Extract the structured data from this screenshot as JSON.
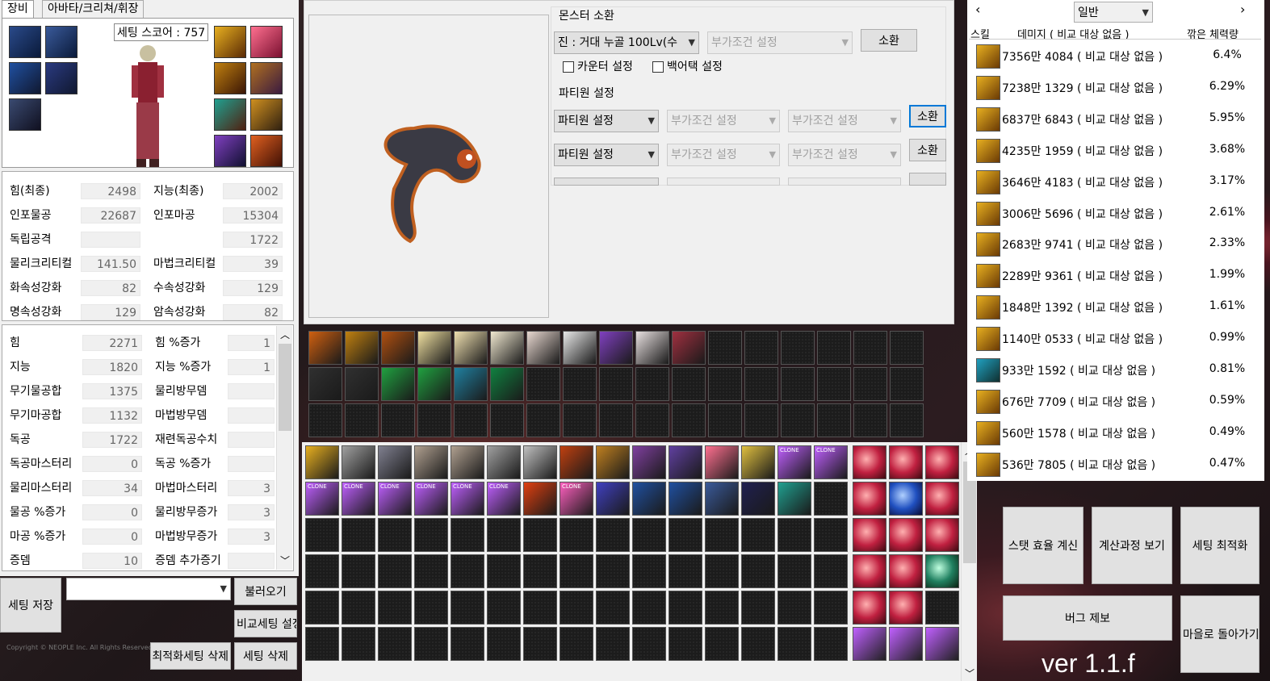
{
  "tabs": [
    "장비",
    "아바타/크리쳐/휘장"
  ],
  "setting_score": "세팅 스코어 : 757",
  "stats_top": [
    {
      "l1": "힘(최종)",
      "v1": "2498",
      "l2": "지능(최종)",
      "v2": "2002"
    },
    {
      "l1": "인포물공",
      "v1": "22687",
      "l2": "인포마공",
      "v2": "15304"
    },
    {
      "l1": "독립공격",
      "v1": "",
      "l2": "",
      "v2": "1722"
    },
    {
      "l1": "물리크리티컬",
      "v1": "141.50",
      "l2": "마법크리티컬",
      "v2": "39"
    },
    {
      "l1": "화속성강화",
      "v1": "82",
      "l2": "수속성강화",
      "v2": "129"
    },
    {
      "l1": "명속성강화",
      "v1": "129",
      "l2": "암속성강화",
      "v2": "82"
    }
  ],
  "stats_bottom": [
    {
      "l1": "힘",
      "v1": "2271",
      "l2": "힘 %증가",
      "v2": "1"
    },
    {
      "l1": "지능",
      "v1": "1820",
      "l2": "지능 %증가",
      "v2": "1"
    },
    {
      "l1": "무기물공합",
      "v1": "1375",
      "l2": "물리방무뎀",
      "v2": ""
    },
    {
      "l1": "무기마공합",
      "v1": "1132",
      "l2": "마법방무뎀",
      "v2": ""
    },
    {
      "l1": "독공",
      "v1": "1722",
      "l2": "재련독공수치",
      "v2": ""
    },
    {
      "l1": "독공마스터리",
      "v1": "0",
      "l2": "독공 %증가",
      "v2": ""
    },
    {
      "l1": "물리마스터리",
      "v1": "34",
      "l2": "마법마스터리",
      "v2": "3"
    },
    {
      "l1": "물공 %증가",
      "v1": "0",
      "l2": "물리방무증가",
      "v2": "3"
    },
    {
      "l1": "마공 %증가",
      "v1": "0",
      "l2": "마법방무증가",
      "v2": "3"
    },
    {
      "l1": "증뎀",
      "v1": "10",
      "l2": "증뎀 추가증기",
      "v2": ""
    }
  ],
  "bottom_left": {
    "save": "세팅 저장",
    "load": "불러오기",
    "compare": "비교세팅 설정",
    "delete_opt": "최적화세팅 삭제",
    "delete": "세팅 삭제",
    "copyright": "Copyright © NEOPLE Inc. All Rights Reserved."
  },
  "monster": {
    "title": "몬스터 소환",
    "select": "진 : 거대 누골 100Lv(수",
    "cond": "부가조건 설정",
    "summon": "소환",
    "counter": "카운터 설정",
    "backattack": "백어택 설정"
  },
  "party": {
    "title": "파티원 설정",
    "member": "파티원 설정",
    "cond": "부가조건 설정",
    "summon": "소환"
  },
  "right_panel": {
    "dropdown": "일반",
    "col_skill": "스킬",
    "col_damage": "데미지 ( 비교 대상 없음 )",
    "col_hp": "깎은 체력량",
    "rows": [
      {
        "dmg": "7356만 4084 ( 비교 대상 없음 )",
        "pct": "6.4%"
      },
      {
        "dmg": "7238만 1329 ( 비교 대상 없음 )",
        "pct": "6.29%"
      },
      {
        "dmg": "6837만 6843 ( 비교 대상 없음 )",
        "pct": "5.95%"
      },
      {
        "dmg": "4235만 1959 ( 비교 대상 없음 )",
        "pct": "3.68%"
      },
      {
        "dmg": "3646만 4183 ( 비교 대상 없음 )",
        "pct": "3.17%"
      },
      {
        "dmg": "3006만 5696 ( 비교 대상 없음 )",
        "pct": "2.61%"
      },
      {
        "dmg": "2683만 9741 ( 비교 대상 없음 )",
        "pct": "2.33%"
      },
      {
        "dmg": "2289만 9361 ( 비교 대상 없음 )",
        "pct": "1.99%"
      },
      {
        "dmg": "1848만 1392 ( 비교 대상 없음 )",
        "pct": "1.61%"
      },
      {
        "dmg": "1140만 0533 ( 비교 대상 없음 )",
        "pct": "0.99%"
      },
      {
        "dmg": "933만 1592 ( 비교 대상 없음 )",
        "pct": "0.81%"
      },
      {
        "dmg": "676만 7709 ( 비교 대상 없음 )",
        "pct": "0.59%"
      },
      {
        "dmg": "560만 1578 ( 비교 대상 없음 )",
        "pct": "0.49%"
      },
      {
        "dmg": "536만 7805 ( 비교 대상 없음 )",
        "pct": "0.47%"
      }
    ]
  },
  "actions": {
    "stat_eff": "스탯 효율 계신",
    "process": "계산과정 보기",
    "optimize": "세팅 최적화",
    "bug": "버그 제보",
    "back": "마을로 돌아가기"
  },
  "version": "ver 1.1.f",
  "clone_label": "CLONE",
  "colors": {
    "slot_dark": "#1c1c1c",
    "gold": "#e8b020",
    "purple": "#c060ff",
    "pink_orb": "#e03060"
  }
}
